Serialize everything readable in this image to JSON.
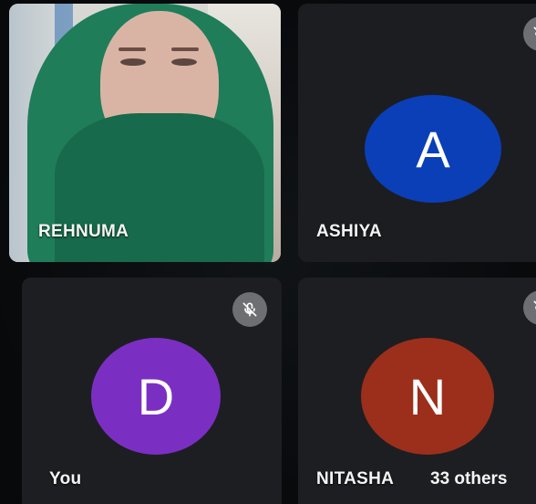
{
  "participants": [
    {
      "name": "REHNUMA",
      "video": true
    },
    {
      "name": "ASHIYA",
      "initial": "A",
      "color": "#0b3fb7",
      "muted": true
    },
    {
      "name": "You",
      "initial": "D",
      "color": "#7b2fc2",
      "muted": true
    },
    {
      "name": "NITASHA",
      "initial": "N",
      "color": "#9b2f1c",
      "muted": true
    }
  ],
  "others_label": "33 others",
  "icons": {
    "mute": "mic-off-icon"
  }
}
